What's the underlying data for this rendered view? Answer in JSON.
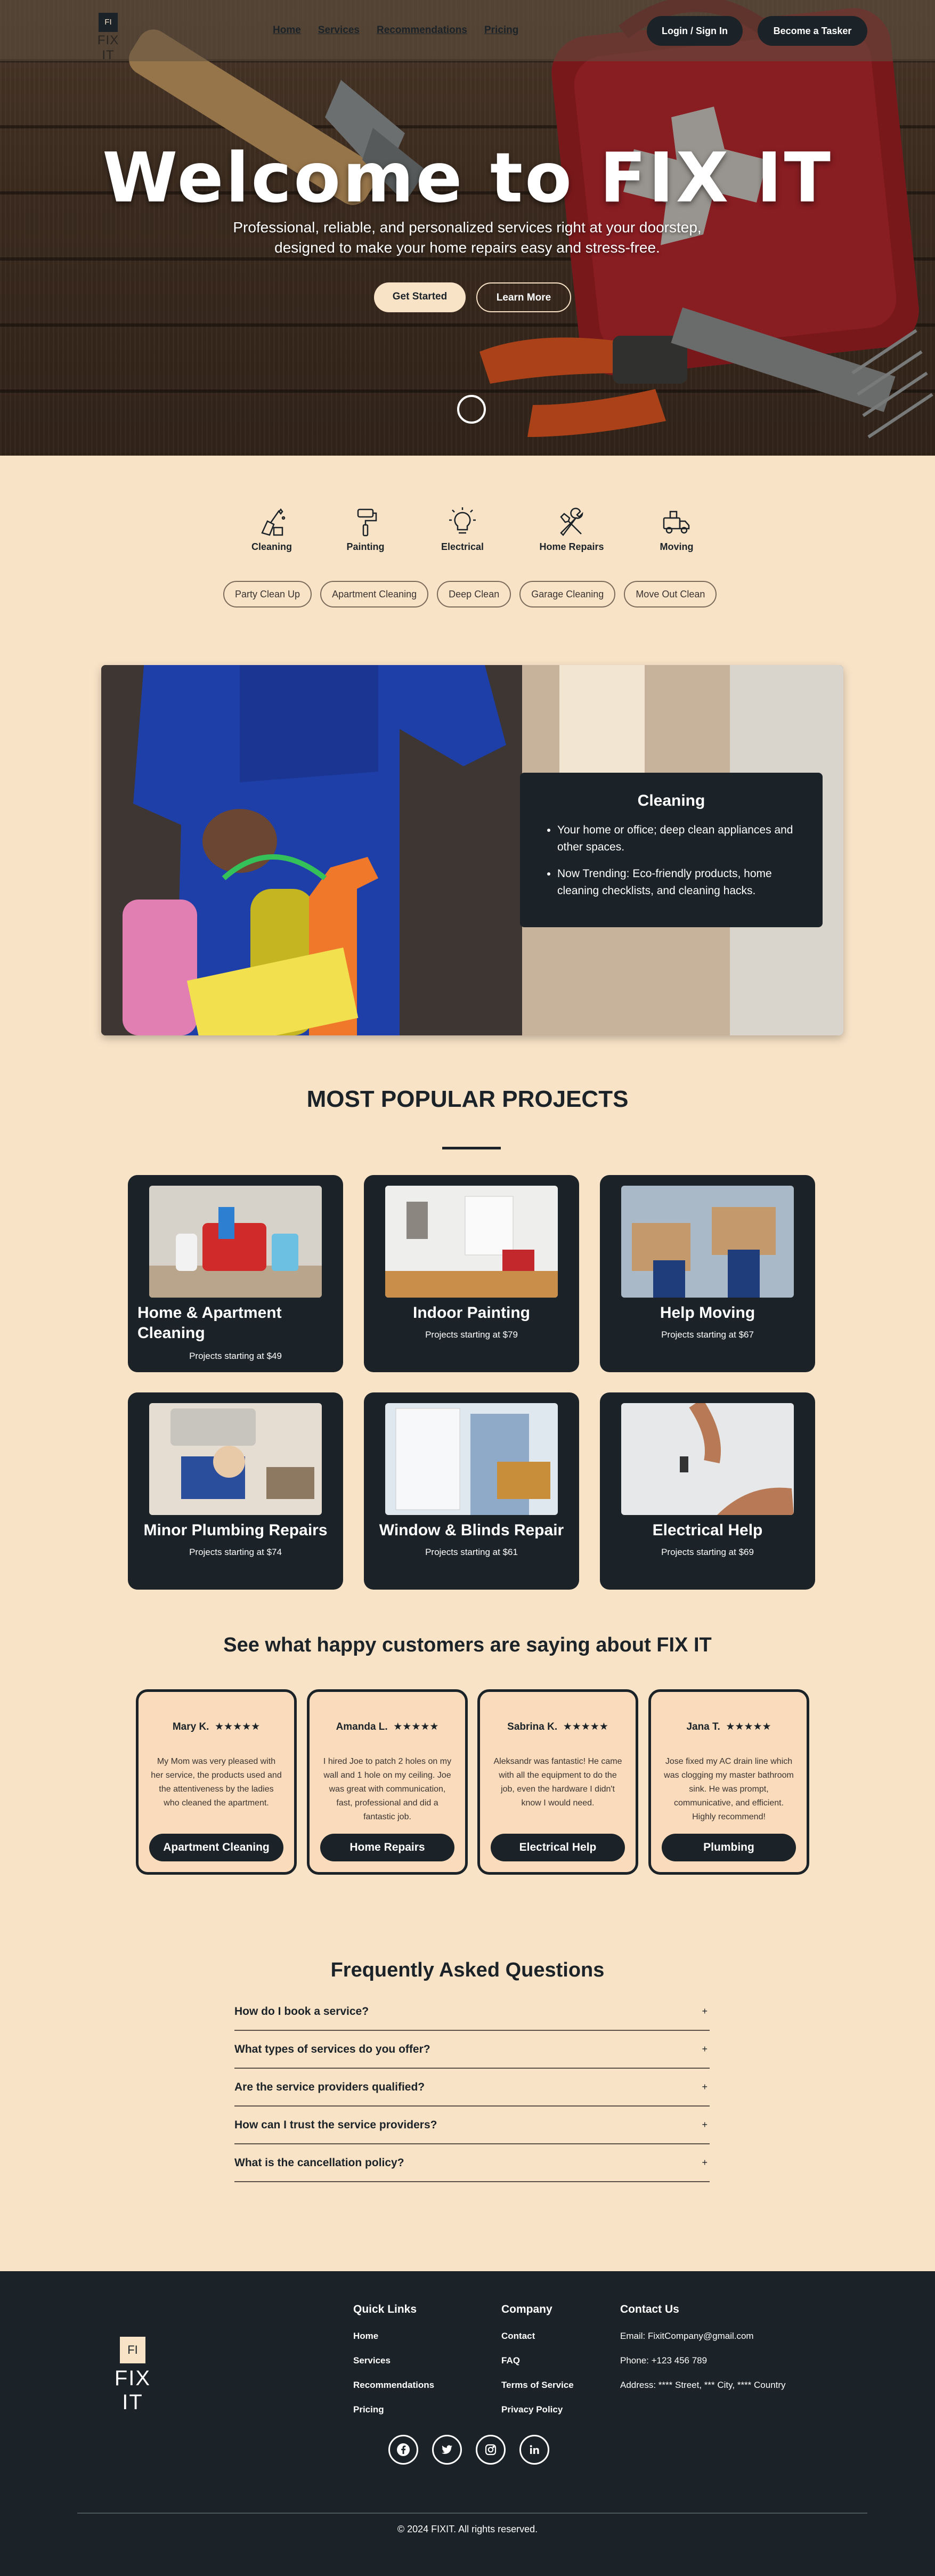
{
  "nav": {
    "logo_mark": "FI",
    "logo_word": "FIX IT",
    "links": [
      "Home",
      "Services",
      "Recommendations",
      "Pricing"
    ],
    "login_label": "Login / Sign In",
    "tasker_label": "Become a Tasker"
  },
  "hero": {
    "title": "Welcome to FIX IT",
    "subtitle": "Professional, reliable, and personalized services right at your doorstep, designed to make your home repairs easy and stress-free.",
    "primary_label": "Get Started",
    "secondary_label": "Learn More"
  },
  "categories": [
    {
      "label": "Cleaning",
      "icon": "cleaning-icon"
    },
    {
      "label": "Painting",
      "icon": "paint-roller-icon"
    },
    {
      "label": "Electrical",
      "icon": "lightbulb-icon"
    },
    {
      "label": "Home Repairs",
      "icon": "tools-icon"
    },
    {
      "label": "Moving",
      "icon": "truck-icon"
    }
  ],
  "chips": [
    "Party Clean Up",
    "Apartment Cleaning",
    "Deep Clean",
    "Garage Cleaning",
    "Move Out Clean"
  ],
  "feature": {
    "title": "Cleaning",
    "bullets": [
      "Your home or office; deep clean appliances and other spaces.",
      "Now Trending: Eco-friendly products, home cleaning checklists, and cleaning hacks."
    ]
  },
  "popular": {
    "title": "MOST POPULAR PROJECTS",
    "projects": [
      {
        "name": "Home & Apartment Cleaning",
        "price": "Projects starting at $49"
      },
      {
        "name": "Indoor Painting",
        "price": "Projects starting at $79"
      },
      {
        "name": "Help Moving",
        "price": "Projects starting at $67"
      },
      {
        "name": "Minor Plumbing Repairs",
        "price": "Projects starting at $74"
      },
      {
        "name": "Window & Blinds Repair",
        "price": "Projects starting at $61"
      },
      {
        "name": "Electrical Help",
        "price": "Projects starting at $69"
      }
    ]
  },
  "testimonials": {
    "title": "See what happy customers are saying about FIX IT",
    "items": [
      {
        "name": "Mary K.",
        "stars": "★★★★★",
        "text": "My Mom was very pleased with her service, the products used and the attentiveness by the ladies who cleaned the apartment.",
        "tag": "Apartment Cleaning"
      },
      {
        "name": "Amanda L.",
        "stars": "★★★★★",
        "text": "I hired Joe to patch 2 holes on my wall and 1 hole on my ceiling. Joe was great with communication, fast, professional and did a fantastic job.",
        "tag": "Home Repairs"
      },
      {
        "name": "Sabrina K.",
        "stars": "★★★★★",
        "text": "Aleksandr was fantastic! He came with all the equipment to do the job, even the hardware I didn't know I would need.",
        "tag": "Electrical Help"
      },
      {
        "name": "Jana T.",
        "stars": "★★★★★",
        "text": "Jose fixed my AC drain line which was clogging my master bathroom sink. He was prompt, communicative, and efficient. Highly recommend!",
        "tag": "Plumbing"
      }
    ]
  },
  "faq": {
    "title": "Frequently Asked Questions",
    "items": [
      "How do I book a service?",
      "What types of services do you offer?",
      "Are the service providers qualified?",
      "How can I trust the service providers?",
      "What is the cancellation policy?"
    ],
    "expand_symbol": "+"
  },
  "footer": {
    "logo_mark": "FI",
    "logo_word": "FIX IT",
    "quick_title": "Quick Links",
    "quick_links": [
      "Home",
      "Services",
      "Recommendations",
      "Pricing"
    ],
    "company_title": "Company",
    "company_links": [
      "Contact",
      "FAQ",
      "Terms of Service",
      "Privacy Policy"
    ],
    "contact_title": "Contact Us",
    "email": "Email: FixitCompany@gmail.com",
    "phone": "Phone: +123 456 789",
    "address": "Address: **** Street, *** City, **** Country",
    "social": [
      "facebook-icon",
      "twitter-icon",
      "instagram-icon",
      "linkedin-icon"
    ],
    "copyright": "© 2024 FIXIT. All rights reserved."
  },
  "colors": {
    "background": "#f9e3c7",
    "dark": "#1b2328",
    "accent_red": "#b3202a"
  }
}
